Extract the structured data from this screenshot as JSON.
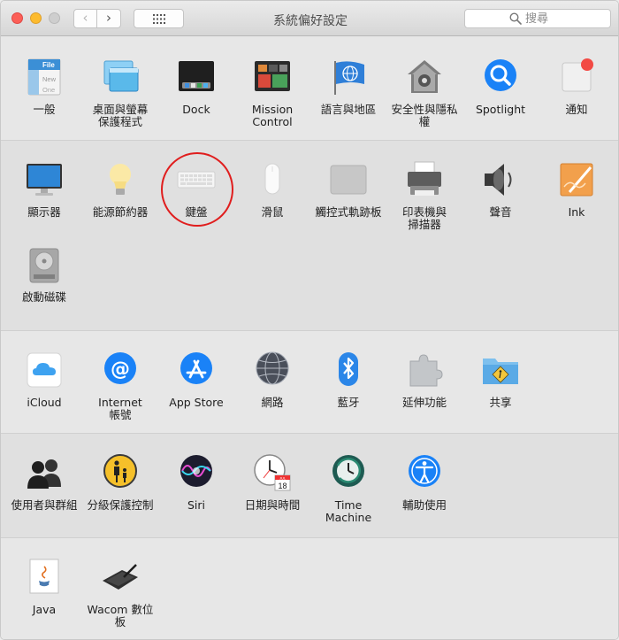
{
  "window": {
    "title": "系統偏好設定"
  },
  "search": {
    "placeholder": "搜尋"
  },
  "sections": [
    {
      "items": [
        {
          "label": "一般",
          "icon": "general-icon",
          "icon_text": {
            "file": "File",
            "new": "New",
            "ope": "One"
          }
        },
        {
          "label": "桌面與螢幕\n保護程式",
          "icon": "desktop-screensaver-icon"
        },
        {
          "label": "Dock",
          "icon": "dock-icon"
        },
        {
          "label": "Mission\nControl",
          "icon": "mission-control-icon"
        },
        {
          "label": "語言與地區",
          "icon": "language-region-icon"
        },
        {
          "label": "安全性與隱私權",
          "icon": "security-privacy-icon"
        },
        {
          "label": "Spotlight",
          "icon": "spotlight-icon"
        },
        {
          "label": "通知",
          "icon": "notifications-icon"
        }
      ]
    },
    {
      "items": [
        {
          "label": "顯示器",
          "icon": "displays-icon"
        },
        {
          "label": "能源節約器",
          "icon": "energy-saver-icon"
        },
        {
          "label": "鍵盤",
          "icon": "keyboard-icon"
        },
        {
          "label": "滑鼠",
          "icon": "mouse-icon"
        },
        {
          "label": "觸控式軌跡板",
          "icon": "trackpad-icon"
        },
        {
          "label": "印表機與\n掃描器",
          "icon": "printers-scanners-icon"
        },
        {
          "label": "聲音",
          "icon": "sound-icon"
        },
        {
          "label": "Ink",
          "icon": "ink-icon"
        },
        {
          "label": "啟動磁碟",
          "icon": "startup-disk-icon"
        }
      ]
    },
    {
      "items": [
        {
          "label": "iCloud",
          "icon": "icloud-icon"
        },
        {
          "label": "Internet\n帳號",
          "icon": "internet-accounts-icon"
        },
        {
          "label": "App Store",
          "icon": "app-store-icon"
        },
        {
          "label": "網路",
          "icon": "network-icon"
        },
        {
          "label": "藍牙",
          "icon": "bluetooth-icon"
        },
        {
          "label": "延伸功能",
          "icon": "extensions-icon"
        },
        {
          "label": "共享",
          "icon": "sharing-icon"
        }
      ]
    },
    {
      "items": [
        {
          "label": "使用者與群組",
          "icon": "users-groups-icon"
        },
        {
          "label": "分級保護控制",
          "icon": "parental-controls-icon"
        },
        {
          "label": "Siri",
          "icon": "siri-icon"
        },
        {
          "label": "日期與時間",
          "icon": "date-time-icon",
          "icon_text": {
            "month": "JUL",
            "day": "18"
          }
        },
        {
          "label": "Time Machine",
          "icon": "time-machine-icon"
        },
        {
          "label": "輔助使用",
          "icon": "accessibility-icon"
        }
      ]
    },
    {
      "items": [
        {
          "label": "Java",
          "icon": "java-icon"
        },
        {
          "label": "Wacom 數位板",
          "icon": "wacom-tablet-icon"
        }
      ]
    }
  ],
  "colors": {
    "highlight_circle": "#e01e1e",
    "accent_blue": "#1a82f7"
  }
}
